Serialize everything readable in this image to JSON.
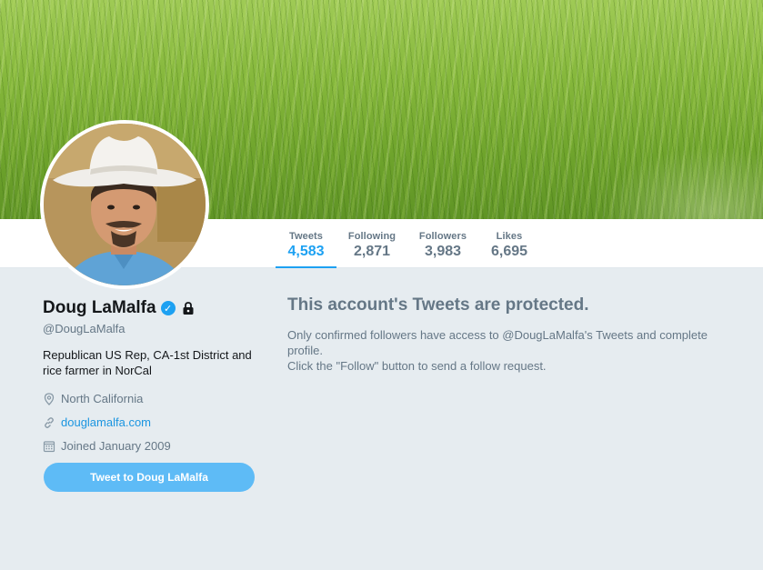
{
  "profile": {
    "name": "Doug LaMalfa",
    "handle": "@DougLaMalfa",
    "bio": "Republican US Rep, CA-1st District and rice farmer in NorCal",
    "location": "North California",
    "website": "douglamalfa.com",
    "joined": "Joined January 2009",
    "tweet_button": "Tweet to Doug LaMalfa"
  },
  "stats": [
    {
      "label": "Tweets",
      "value": "4,583"
    },
    {
      "label": "Following",
      "value": "2,871"
    },
    {
      "label": "Followers",
      "value": "3,983"
    },
    {
      "label": "Likes",
      "value": "6,695"
    }
  ],
  "protected": {
    "title": "This account's Tweets are protected.",
    "line1": "Only confirmed followers have access to @DougLaMalfa's Tweets and complete profile.",
    "line2": "Click the \"Follow\" button to send a follow request."
  },
  "colors": {
    "accent": "#1da1f2",
    "button": "#5ebbf6",
    "background": "#e6ecf0",
    "muted": "#657786"
  },
  "icons": {
    "verified": "verified-badge-icon",
    "lock": "lock-icon",
    "location": "location-pin-icon",
    "link": "link-icon",
    "calendar": "calendar-icon"
  }
}
